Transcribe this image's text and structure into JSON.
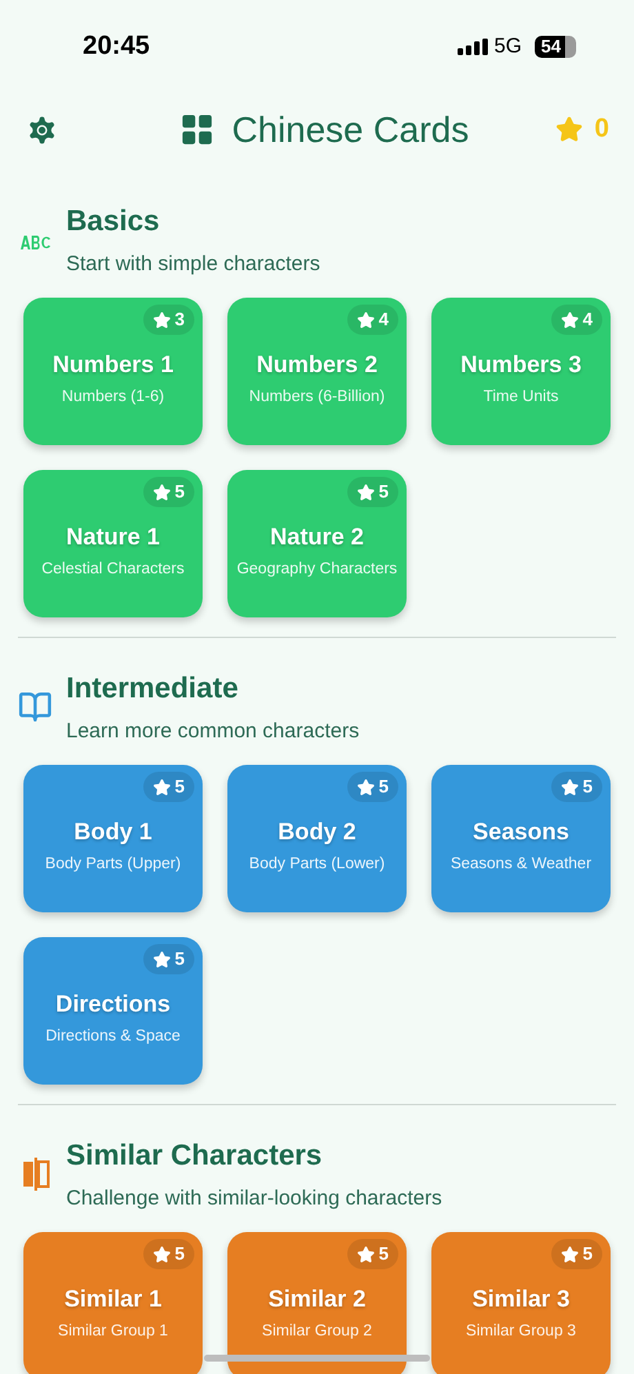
{
  "status_bar": {
    "time": "20:45",
    "network": "5G",
    "battery": "54"
  },
  "header": {
    "title": "Chinese Cards",
    "stars": "0"
  },
  "sections": [
    {
      "kind": "abc",
      "title": "Basics",
      "subtitle": "Start with simple characters",
      "color": "#2ecc71",
      "cards": [
        {
          "title": "Numbers 1",
          "subtitle": "Numbers (1-6)",
          "count": "3"
        },
        {
          "title": "Numbers 2",
          "subtitle": "Numbers (6-Billion)",
          "count": "4"
        },
        {
          "title": "Numbers 3",
          "subtitle": "Time Units",
          "count": "4"
        },
        {
          "title": "Nature 1",
          "subtitle": "Celestial Characters",
          "count": "5"
        },
        {
          "title": "Nature 2",
          "subtitle": "Geography Characters",
          "count": "5"
        }
      ]
    },
    {
      "kind": "book",
      "title": "Intermediate",
      "subtitle": "Learn more common characters",
      "color": "#3498db",
      "cards": [
        {
          "title": "Body 1",
          "subtitle": "Body Parts (Upper)",
          "count": "5"
        },
        {
          "title": "Body 2",
          "subtitle": "Body Parts (Lower)",
          "count": "5"
        },
        {
          "title": "Seasons",
          "subtitle": "Seasons & Weather",
          "count": "5"
        },
        {
          "title": "Directions",
          "subtitle": "Directions & Space",
          "count": "5"
        }
      ]
    },
    {
      "kind": "swap",
      "title": "Similar Characters",
      "subtitle": "Challenge with similar-looking characters",
      "color": "#e67e22",
      "cards": [
        {
          "title": "Similar 1",
          "subtitle": "Similar Group 1",
          "count": "5"
        },
        {
          "title": "Similar 2",
          "subtitle": "Similar Group 2",
          "count": "5"
        },
        {
          "title": "Similar 3",
          "subtitle": "Similar Group 3",
          "count": "5"
        }
      ]
    }
  ]
}
